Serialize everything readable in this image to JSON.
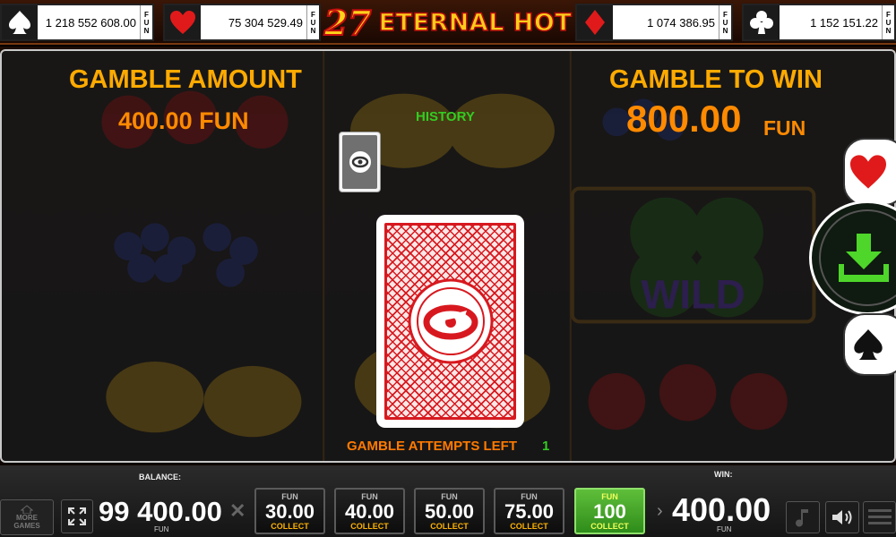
{
  "jackpots": [
    {
      "suit": "spade-icon",
      "value": "1 218 552 608.00",
      "currency": [
        "F",
        "U",
        "N"
      ]
    },
    {
      "suit": "heart-icon",
      "value": "75 304 529.49",
      "currency": [
        "F",
        "U",
        "N"
      ]
    },
    {
      "suit": "diamond-icon",
      "value": "1 074 386.95",
      "currency": [
        "F",
        "U",
        "N"
      ]
    },
    {
      "suit": "club-icon",
      "value": "1 152 151.22",
      "currency": [
        "F",
        "U",
        "N"
      ]
    }
  ],
  "title": {
    "number": "27",
    "name": "ETERNAL HOT"
  },
  "gamble": {
    "amount_label": "GAMBLE AMOUNT",
    "amount_value": "400.00 FUN",
    "to_win_label": "GAMBLE TO WIN",
    "to_win_value": "800.00",
    "to_win_currency": "FUN",
    "history_label": "HISTORY",
    "attempts_label": "GAMBLE ATTEMPTS LEFT",
    "attempts_value": "1"
  },
  "reel_watermark": "WILD",
  "bottom": {
    "more_games": [
      "MORE",
      "GAMES"
    ],
    "balance_label": "BALANCE:",
    "balance_value": "99 400.00",
    "balance_currency": "FUN",
    "win_label": "WIN:",
    "win_value": "400.00",
    "win_currency": "FUN",
    "collect_buttons": [
      {
        "currency": "FUN",
        "amount": "30.00",
        "label": "COLLECT"
      },
      {
        "currency": "FUN",
        "amount": "40.00",
        "label": "COLLECT"
      },
      {
        "currency": "FUN",
        "amount": "50.00",
        "label": "COLLECT"
      },
      {
        "currency": "FUN",
        "amount": "75.00",
        "label": "COLLECT"
      },
      {
        "currency": "FUN",
        "amount": "100",
        "label": "COLLECT",
        "active": true
      }
    ]
  },
  "colors": {
    "gold": "#ffaa00",
    "orange": "#ff8a00",
    "green": "#33cc22",
    "card_red": "#d7191f"
  }
}
